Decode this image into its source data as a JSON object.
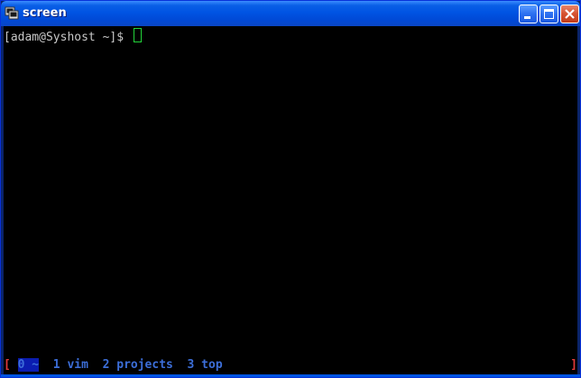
{
  "window": {
    "title": "screen"
  },
  "terminal": {
    "prompt": "[adam@Syshost ~]$ "
  },
  "statusline": {
    "open_bracket": "[",
    "close_bracket": "]",
    "windows": [
      {
        "label": "0 ~",
        "active": true
      },
      {
        "label": "1 vim",
        "active": false
      },
      {
        "label": "2 projects",
        "active": false
      },
      {
        "label": "3 top",
        "active": false
      }
    ]
  },
  "colors": {
    "titlebar": "#0054e3",
    "terminal_bg": "#000000",
    "cursor": "#22d43a",
    "status_bracket": "#e23a3a",
    "status_window": "#3c6ed8",
    "status_active_bg": "#0b1db0"
  },
  "icons": {
    "app": "terminal-icon",
    "minimize": "minimize-icon",
    "maximize": "maximize-icon",
    "close": "close-icon"
  }
}
